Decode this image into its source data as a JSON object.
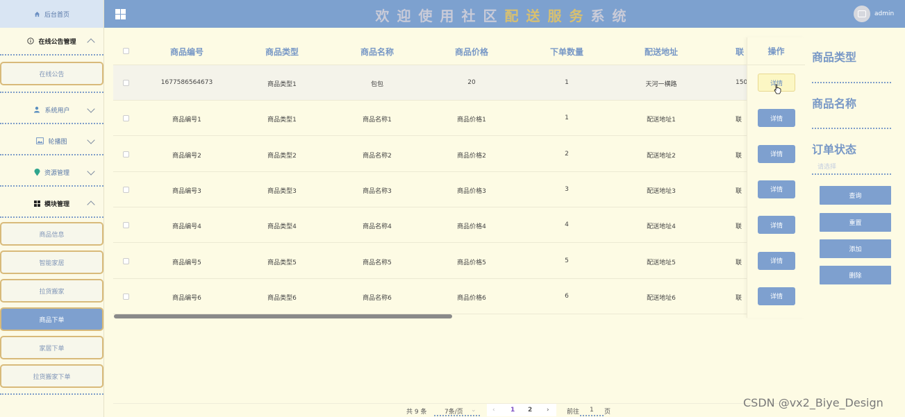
{
  "header": {
    "title_part1": "欢迎使用社区",
    "title_part2": "配送服务",
    "title_part3": "系统",
    "user": "admin"
  },
  "sidebar": {
    "home": "后台首页",
    "groups": [
      {
        "label": "在线公告管理",
        "sub": [
          "在线公告"
        ]
      },
      {
        "label": "系统用户"
      },
      {
        "label": "轮播图"
      },
      {
        "label": "资源管理"
      },
      {
        "label": "模块管理",
        "sub": [
          "商品信息",
          "智能家居",
          "拉货搬家",
          "商品下单",
          "家居下单",
          "拉货搬家下单"
        ]
      }
    ]
  },
  "table": {
    "headers": [
      "商品编号",
      "商品类型",
      "商品名称",
      "商品价格",
      "下单数量",
      "配送地址",
      "联"
    ],
    "ops_header": "操作",
    "detail_label": "详情",
    "rows": [
      [
        "1677586564673",
        "商品类型1",
        "包包",
        "20",
        "1",
        "天河一横路",
        "150"
      ],
      [
        "商品编号1",
        "商品类型1",
        "商品名称1",
        "商品价格1",
        "1",
        "配送地址1",
        "联"
      ],
      [
        "商品编号2",
        "商品类型2",
        "商品名称2",
        "商品价格2",
        "2",
        "配送地址2",
        "联"
      ],
      [
        "商品编号3",
        "商品类型3",
        "商品名称3",
        "商品价格3",
        "3",
        "配送地址3",
        "联"
      ],
      [
        "商品编号4",
        "商品类型4",
        "商品名称4",
        "商品价格4",
        "4",
        "配送地址4",
        "联"
      ],
      [
        "商品编号5",
        "商品类型5",
        "商品名称5",
        "商品价格5",
        "5",
        "配送地址5",
        "联"
      ],
      [
        "商品编号6",
        "商品类型6",
        "商品名称6",
        "商品价格6",
        "6",
        "配送地址6",
        "联"
      ]
    ]
  },
  "search": {
    "label_type": "商品类型",
    "label_name": "商品名称",
    "label_status": "订单状态",
    "status_placeholder": "请选择",
    "btn_query": "查询",
    "btn_reset": "重置",
    "btn_add": "添加",
    "btn_delete": "删除"
  },
  "pager": {
    "total": "共 9 条",
    "page_size": "7条/页",
    "prev": "‹",
    "page1": "1",
    "page2": "2",
    "next": "›",
    "goto_label": "前往",
    "goto_value": "1",
    "page_unit": "页"
  },
  "watermark": "CSDN @vx2_Biye_Design"
}
